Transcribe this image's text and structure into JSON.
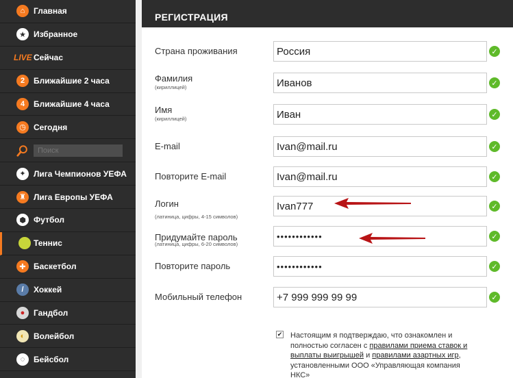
{
  "sidebar": {
    "items": [
      {
        "label": "Главная",
        "icon": "home-icon"
      },
      {
        "label": "Избранное",
        "icon": "star-icon"
      },
      {
        "label": "Сейчас",
        "icon": "live-badge",
        "badge": "LIVE"
      },
      {
        "label": "Ближайшие 2 часа",
        "icon": "two-hours-icon",
        "badge": "2"
      },
      {
        "label": "Ближайшие 4 часа",
        "icon": "four-hours-icon",
        "badge": "4"
      },
      {
        "label": "Сегодня",
        "icon": "clock-icon"
      },
      {
        "label": "",
        "icon": "search-icon"
      },
      {
        "label": "Лига Чемпионов УЕФА",
        "icon": "uefa-cl-icon"
      },
      {
        "label": "Лига Европы УЕФА",
        "icon": "uefa-el-icon"
      },
      {
        "label": "Футбол",
        "icon": "football-icon"
      },
      {
        "label": "Теннис",
        "icon": "tennis-icon"
      },
      {
        "label": "Баскетбол",
        "icon": "basketball-icon"
      },
      {
        "label": "Хоккей",
        "icon": "hockey-icon"
      },
      {
        "label": "Гандбол",
        "icon": "handball-icon"
      },
      {
        "label": "Волейбол",
        "icon": "volleyball-icon"
      },
      {
        "label": "Бейсбол",
        "icon": "baseball-icon"
      }
    ],
    "search_placeholder": "Поиск"
  },
  "form": {
    "title": "РЕГИСТРАЦИЯ",
    "fields": [
      {
        "label": "Страна проживания",
        "hint": "",
        "value": "Россия"
      },
      {
        "label": "Фамилия",
        "hint": "(кириллицей)",
        "value": "Иванов"
      },
      {
        "label": "Имя",
        "hint": "(кириллицей)",
        "value": "Иван"
      },
      {
        "label": "E-mail",
        "hint": "",
        "value": "Ivan@mail.ru"
      },
      {
        "label": "Повторите E-mail",
        "hint": "",
        "value": "Ivan@mail.ru"
      },
      {
        "label": "Логин",
        "hint": "(латиница, цифры, 4-15 символов)",
        "value": "Ivan777"
      },
      {
        "label": "Придумайте пароль",
        "hint": "(латиница, цифры, 6-20 символов)",
        "value": "••••••••••••"
      },
      {
        "label": "Повторите пароль",
        "hint": "",
        "value": "••••••••••••"
      },
      {
        "label": "Мобильный телефон",
        "hint": "",
        "value": "+7 999 999 99 99"
      }
    ],
    "consent": {
      "checked": "✔",
      "part1": "Настоящим я подтверждаю, что ознакомлен и полностью согласен с ",
      "link1": "правилами приема ставок и выплаты выигрышей",
      "part2": " и ",
      "link2": "правилами азартных игр",
      "part3": ", установленными ООО «Управляющая компания НКС»"
    }
  },
  "colors": {
    "accent": "#f57a20",
    "valid": "#5fba2a",
    "arrow": "#b81416",
    "sidebar": "#2d2d2d"
  }
}
